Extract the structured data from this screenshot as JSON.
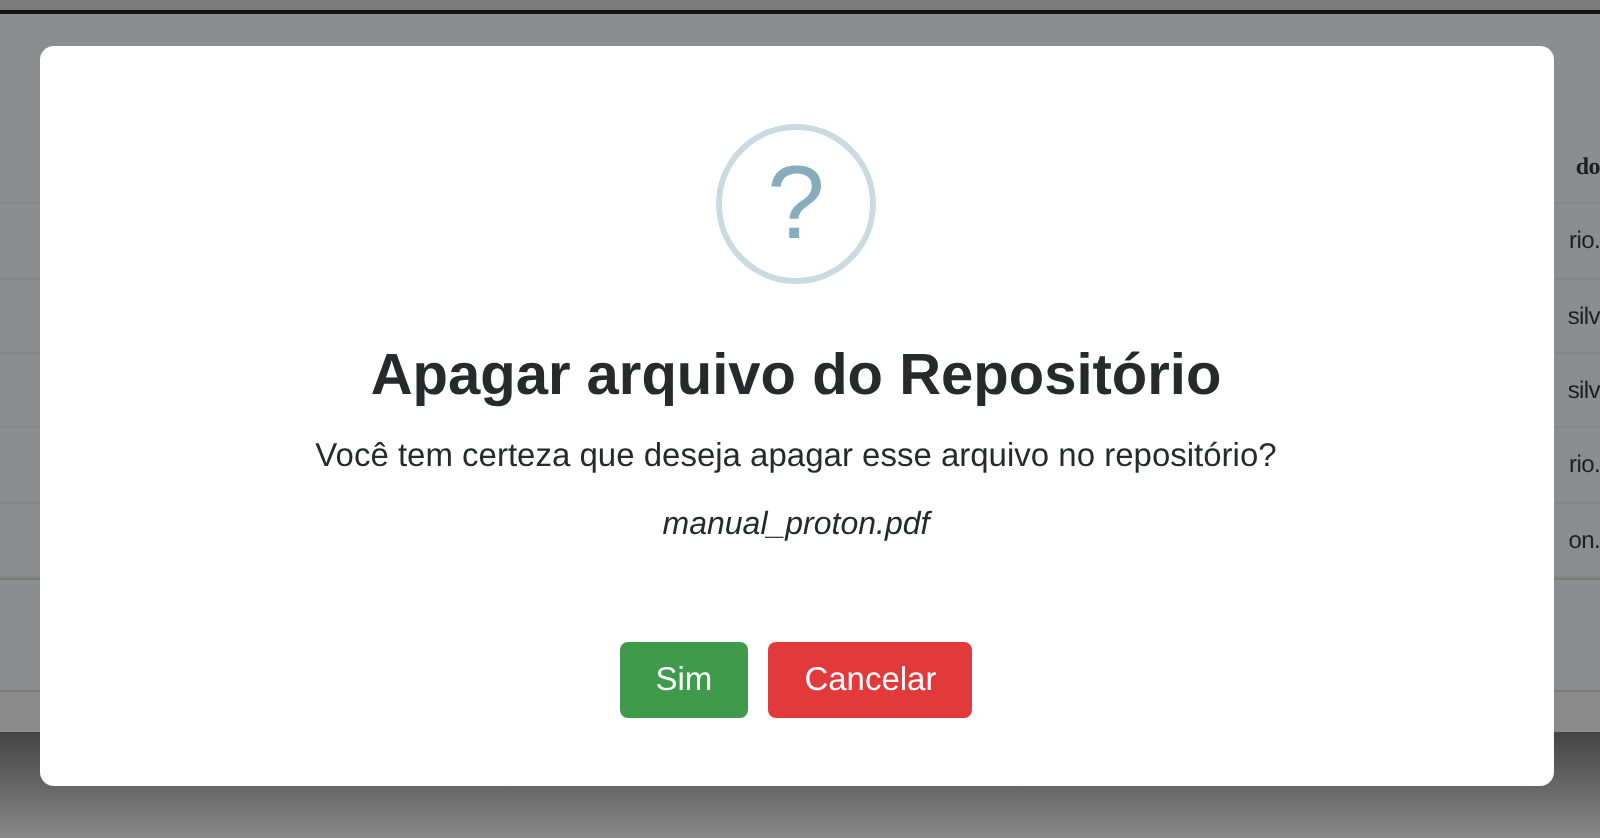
{
  "background_table": {
    "column_header": "do",
    "cells": [
      "rio.",
      "silv",
      "silv",
      "rio.",
      "on."
    ]
  },
  "dialog": {
    "title": "Apagar arquivo do Repositório",
    "message": "Você tem certeza que deseja apagar esse arquivo no repositório?",
    "filename": "manual_proton.pdf",
    "icon": "?",
    "buttons": [
      {
        "label": "Sim",
        "kind": "confirm"
      },
      {
        "label": "Cancelar",
        "kind": "cancel"
      }
    ]
  }
}
